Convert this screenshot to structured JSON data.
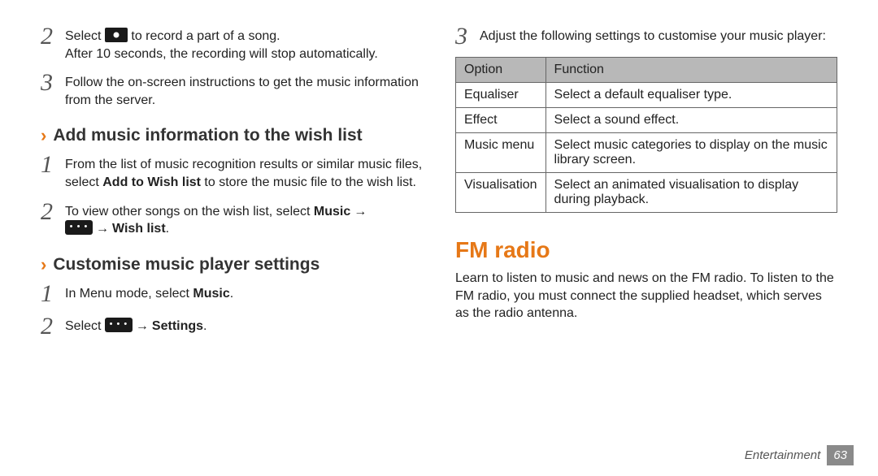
{
  "left": {
    "step2": {
      "num": "2",
      "line1a": "Select ",
      "line1b": " to record a part of a song.",
      "line2": "After 10 seconds, the recording will stop automatically."
    },
    "step3": {
      "num": "3",
      "text": "Follow the on-screen instructions to get the music information from the server."
    },
    "heading_wish": "Add music information to the wish list",
    "wish_step1": {
      "num": "1",
      "pre": "From the list of music recognition results or similar music files, select ",
      "bold": "Add to Wish list",
      "post": " to store the music file to the wish list."
    },
    "wish_step2": {
      "num": "2",
      "pre": "To view other songs on the wish list, select ",
      "bold1": "Music",
      "arrow1": " → ",
      "arrow2": " → ",
      "bold2": "Wish list",
      "post": "."
    },
    "heading_custom": "Customise music player settings",
    "custom_step1": {
      "num": "1",
      "pre": "In Menu mode, select ",
      "bold": "Music",
      "post": "."
    },
    "custom_step2": {
      "num": "2",
      "pre": "Select ",
      "arrow": " → ",
      "bold": "Settings",
      "post": "."
    }
  },
  "right": {
    "step3": {
      "num": "3",
      "text": "Adjust the following settings to customise your music player:"
    },
    "table": {
      "headers": {
        "option": "Option",
        "function": "Function"
      },
      "rows": [
        {
          "option": "Equaliser",
          "function": "Select a default equaliser type."
        },
        {
          "option": "Effect",
          "function": "Select a sound effect."
        },
        {
          "option": "Music menu",
          "function": "Select music categories to display on the music library screen."
        },
        {
          "option": "Visualisation",
          "function": "Select an animated visualisation to display during playback."
        }
      ]
    },
    "fm_heading": "FM radio",
    "fm_para": "Learn to listen to music and news on the FM radio. To listen to the FM radio, you must connect the supplied headset, which serves as the radio antenna."
  },
  "footer": {
    "section": "Entertainment",
    "page": "63"
  }
}
